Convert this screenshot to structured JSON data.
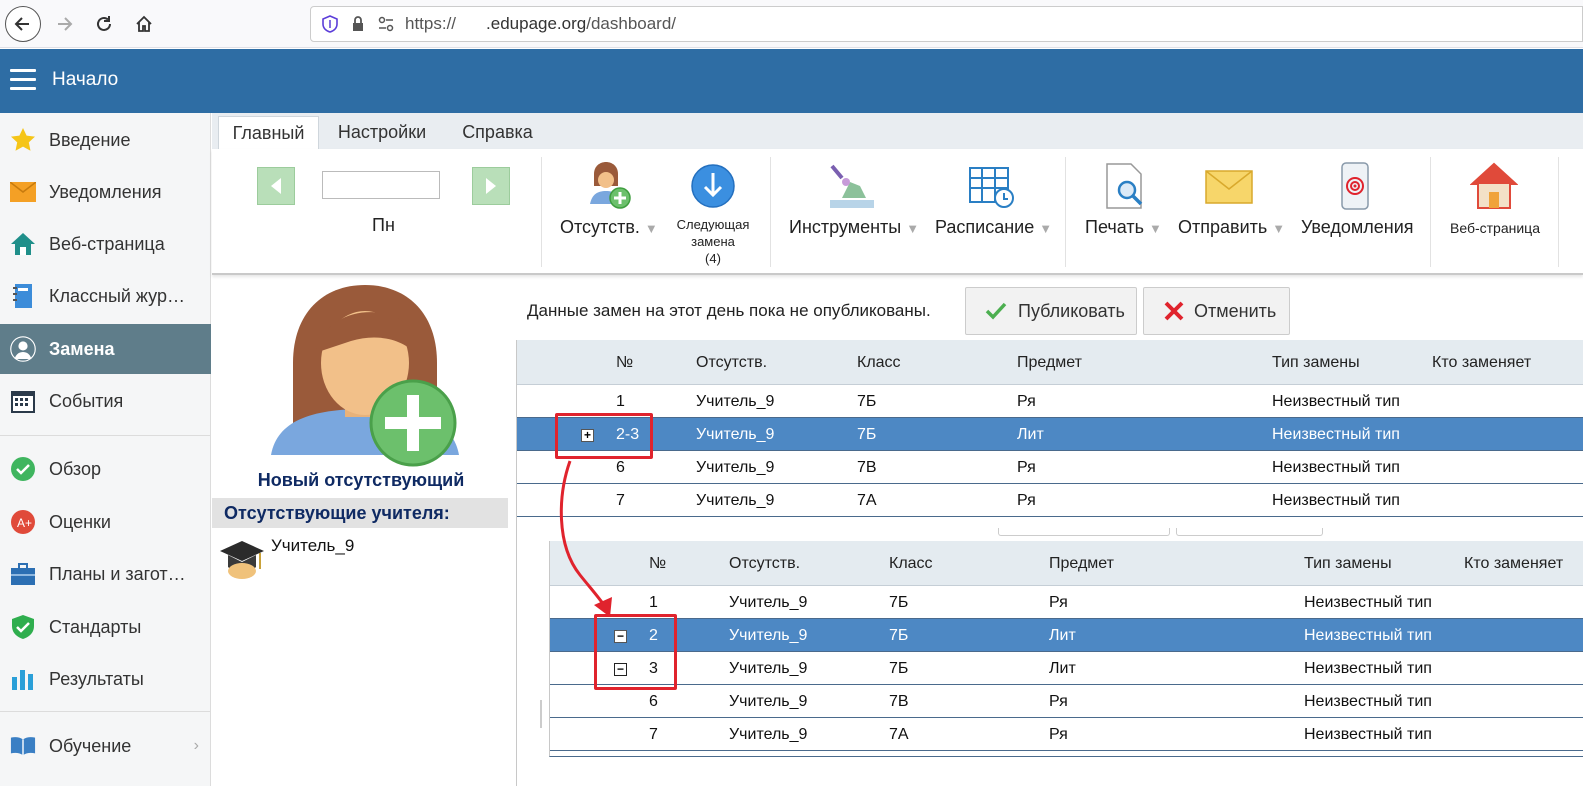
{
  "browser": {
    "url_scheme": "https://",
    "url_domain": ".edupage.org",
    "url_path": "/dashboard/"
  },
  "header": {
    "title": "Начало"
  },
  "sidebar": {
    "items": [
      {
        "label": "Введение",
        "icon": "star-icon"
      },
      {
        "label": "Уведомления",
        "icon": "envelope-icon"
      },
      {
        "label": "Веб-страница",
        "icon": "house-icon"
      },
      {
        "label": "Классный жур…",
        "icon": "notebook-icon"
      },
      {
        "label": "Замена",
        "icon": "person-icon"
      },
      {
        "label": "События",
        "icon": "calendar-icon"
      },
      {
        "label": "Обзор",
        "icon": "check-circle-icon"
      },
      {
        "label": "Оценки",
        "icon": "grades-icon"
      },
      {
        "label": "Планы и загот…",
        "icon": "briefcase-icon"
      },
      {
        "label": "Стандарты",
        "icon": "shield-icon"
      },
      {
        "label": "Результаты",
        "icon": "bar-chart-icon"
      },
      {
        "label": "Обучение",
        "icon": "book-icon"
      }
    ]
  },
  "tabs": [
    "Главный",
    "Настройки",
    "Справка"
  ],
  "ribbon": {
    "day": "Пн",
    "absent": "Отсутств.",
    "next_line1": "Следующая",
    "next_line2": "замена",
    "next_count": "(4)",
    "tools": "Инструменты",
    "schedule": "Расписание",
    "print": "Печать",
    "send": "Отправить",
    "notifications": "Уведомления",
    "webpage": "Веб-страница"
  },
  "left_panel": {
    "new_absent": "Новый отсутствующий",
    "absent_title": "Отсутствующие учителя:",
    "teacher": "Учитель_9"
  },
  "notice": "Данные замен на этот день пока не опубликованы.",
  "buttons": {
    "publish": "Публиковать",
    "cancel": "Отменить"
  },
  "columns": [
    "№",
    "Отсутств.",
    "Класс",
    "Предмет",
    "Тип замены",
    "Кто заменяет"
  ],
  "table1": [
    {
      "n": "1",
      "teacher": "Учитель_9",
      "class": "7Б",
      "subject": "Ря",
      "type": "Неизвестный тип"
    },
    {
      "n": "2-3",
      "teacher": "Учитель_9",
      "class": "7Б",
      "subject": "Лит",
      "type": "Неизвестный тип"
    },
    {
      "n": "6",
      "teacher": "Учитель_9",
      "class": "7В",
      "subject": "Ря",
      "type": "Неизвестный тип"
    },
    {
      "n": "7",
      "teacher": "Учитель_9",
      "class": "7А",
      "subject": "Ря",
      "type": "Неизвестный тип"
    }
  ],
  "table2": [
    {
      "n": "1",
      "teacher": "Учитель_9",
      "class": "7Б",
      "subject": "Ря",
      "type": "Неизвестный тип"
    },
    {
      "n": "2",
      "teacher": "Учитель_9",
      "class": "7Б",
      "subject": "Лит",
      "type": "Неизвестный тип"
    },
    {
      "n": "3",
      "teacher": "Учитель_9",
      "class": "7Б",
      "subject": "Лит",
      "type": "Неизвестный тип"
    },
    {
      "n": "6",
      "teacher": "Учитель_9",
      "class": "7В",
      "subject": "Ря",
      "type": "Неизвестный тип"
    },
    {
      "n": "7",
      "teacher": "Учитель_9",
      "class": "7А",
      "subject": "Ря",
      "type": "Неизвестный тип"
    }
  ],
  "colors": {
    "header": "#2e6da4",
    "selected_row": "#4d88c4",
    "sidebar_active": "#5f7d8a",
    "annotation": "#e0232d"
  }
}
